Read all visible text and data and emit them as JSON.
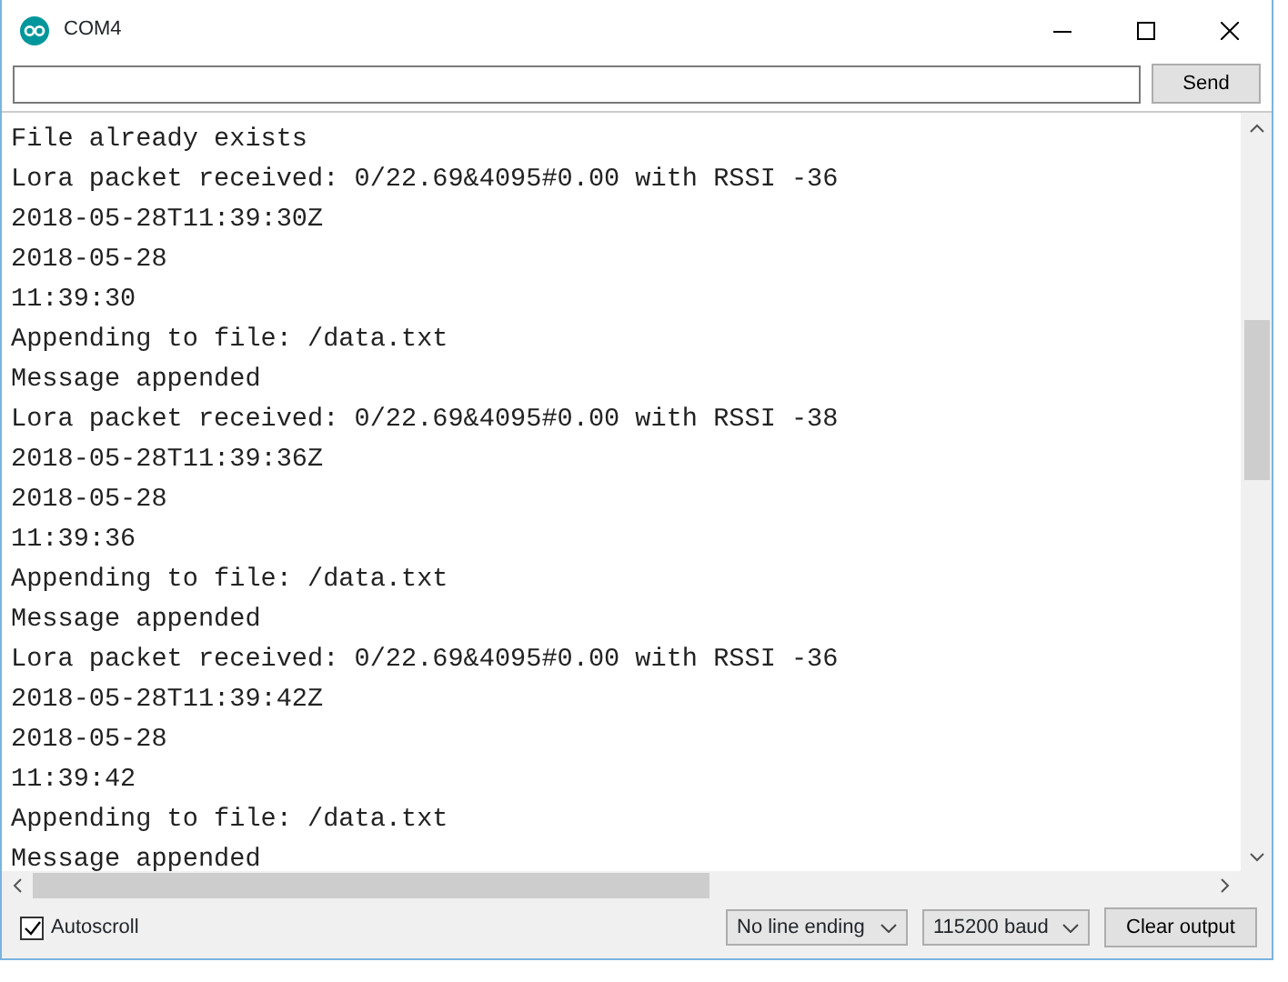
{
  "window": {
    "title": "COM4"
  },
  "send_button": "Send",
  "output_lines": [
    "File already exists",
    "Lora packet received: 0/22.69&4095#0.00 with RSSI -36",
    "2018-05-28T11:39:30Z",
    "2018-05-28",
    "11:39:30",
    "Appending to file: /data.txt",
    "Message appended",
    "Lora packet received: 0/22.69&4095#0.00 with RSSI -38",
    "2018-05-28T11:39:36Z",
    "2018-05-28",
    "11:39:36",
    "Appending to file: /data.txt",
    "Message appended",
    "Lora packet received: 0/22.69&4095#0.00 with RSSI -36",
    "2018-05-28T11:39:42Z",
    "2018-05-28",
    "11:39:42",
    "Appending to file: /data.txt",
    "Message appended"
  ],
  "autoscroll": {
    "label": "Autoscroll",
    "checked": true
  },
  "line_ending": "No line ending",
  "baud_rate": "115200 baud",
  "clear_button": "Clear output"
}
